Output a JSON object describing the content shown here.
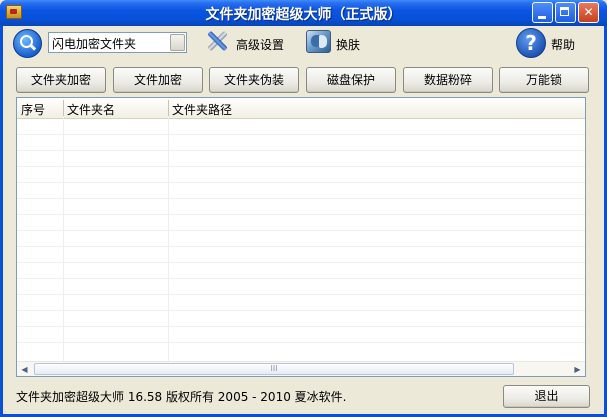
{
  "window": {
    "title": "文件夹加密超级大师（正式版）",
    "controls": {
      "minimize": "",
      "maximize": "",
      "close": "✕"
    }
  },
  "toolbar": {
    "mode_select_value": "闪电加密文件夹",
    "advanced_settings_label": "高级设置",
    "skin_label": "换肤",
    "help_label": "帮助",
    "help_glyph": "?"
  },
  "actions": {
    "folder_encrypt": "文件夹加密",
    "file_encrypt": "文件加密",
    "folder_disguise": "文件夹伪装",
    "disk_protect": "磁盘保护",
    "data_shred": "数据粉碎",
    "master_lock": "万能锁"
  },
  "table": {
    "columns": [
      "序号",
      "文件夹名",
      "文件夹路径"
    ],
    "rows": [],
    "scroll_grip": "III"
  },
  "footer": {
    "copyright": "文件夹加密超级大师 16.58 版权所有 2005 - 2010 夏冰软件.",
    "exit_label": "退出"
  },
  "colors": {
    "titlebar": "#0a55e2",
    "window_bg": "#ece9d8",
    "border": "#0a50d8"
  },
  "icons": [
    "app-icon",
    "search-icon",
    "tools-icon",
    "skin-icon",
    "help-icon"
  ]
}
